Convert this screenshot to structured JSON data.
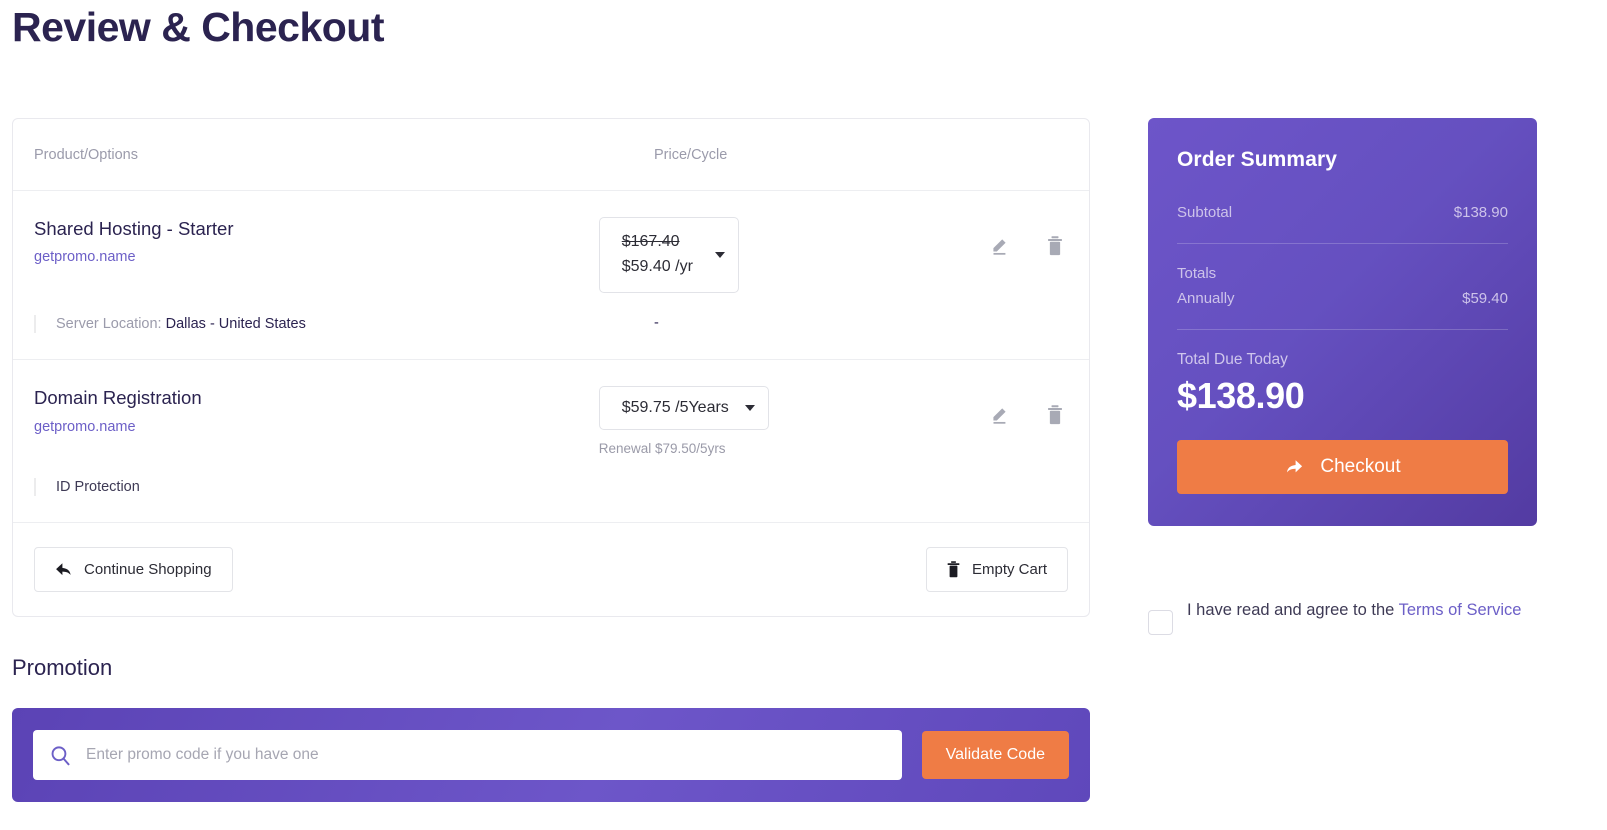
{
  "page": {
    "title": "Review & Checkout"
  },
  "cart": {
    "headers": {
      "product": "Product/Options",
      "price": "Price/Cycle"
    },
    "items": [
      {
        "name": "Shared Hosting - Starter",
        "domain": "getpromo.name",
        "price_old": "$167.40",
        "price_new": "$59.40 /yr",
        "option_label": "Server Location:",
        "option_value": "Dallas - United States",
        "option_price": "-"
      },
      {
        "name": "Domain Registration",
        "domain": "getpromo.name",
        "price": "$59.75 /5Years",
        "renewal": "Renewal $79.50/5yrs",
        "addon": "ID Protection"
      }
    ],
    "footer": {
      "continue_shopping": "Continue Shopping",
      "empty_cart": "Empty Cart"
    }
  },
  "promotion": {
    "heading": "Promotion",
    "placeholder": "Enter promo code if you have one",
    "value": "",
    "validate_label": "Validate Code"
  },
  "summary": {
    "title": "Order Summary",
    "subtotal_label": "Subtotal",
    "subtotal_value": "$138.90",
    "totals_label": "Totals",
    "annually_label": "Annually",
    "annually_value": "$59.40",
    "total_due_label": "Total Due Today",
    "total_due_value": "$138.90",
    "checkout_label": "Checkout"
  },
  "terms": {
    "text": "I have read and agree to the ",
    "link": "Terms of Service"
  },
  "colors": {
    "brand_purple": "#6d55c9",
    "brand_purple_dark": "#533ba2",
    "accent_orange": "#ef7c45",
    "heading": "#2b2350",
    "link": "#6c5fc7",
    "muted": "#9b9bab"
  }
}
